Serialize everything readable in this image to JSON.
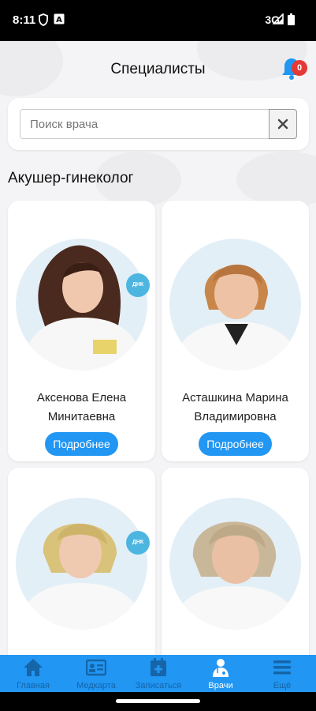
{
  "status_bar": {
    "time": "8:11",
    "network": "3G",
    "icons": [
      "shield-icon",
      "a-box-icon",
      "signal-icon",
      "battery-icon"
    ]
  },
  "header": {
    "title": "Специалисты",
    "notifications_count": "0",
    "bell_color": "#2196f3",
    "badge_color": "#e53935"
  },
  "search": {
    "placeholder": "Поиск врача",
    "value": ""
  },
  "section": {
    "title": "Акушер-гинеколог"
  },
  "doctors": [
    {
      "name_line1": "Аксенова Елена",
      "name_line2": "Минитаевна",
      "button": "Подробнее",
      "badge": "ДНК"
    },
    {
      "name_line1": "Асташкина Марина",
      "name_line2": "Владимировна",
      "button": "Подробнее"
    },
    {
      "name_line1": "",
      "name_line2": "",
      "button": "",
      "badge": "ДНК"
    },
    {
      "name_line1": "",
      "name_line2": "",
      "button": ""
    }
  ],
  "bottom_nav": {
    "items": [
      {
        "label": "Главная",
        "icon": "home-icon"
      },
      {
        "label": "Медкарта",
        "icon": "id-card-icon"
      },
      {
        "label": "Записаться",
        "icon": "calendar-plus-icon"
      },
      {
        "label": "Врачи",
        "icon": "doctor-icon",
        "active": true
      },
      {
        "label": "Ещё",
        "icon": "menu-icon"
      }
    ],
    "background": "#2196f3"
  }
}
